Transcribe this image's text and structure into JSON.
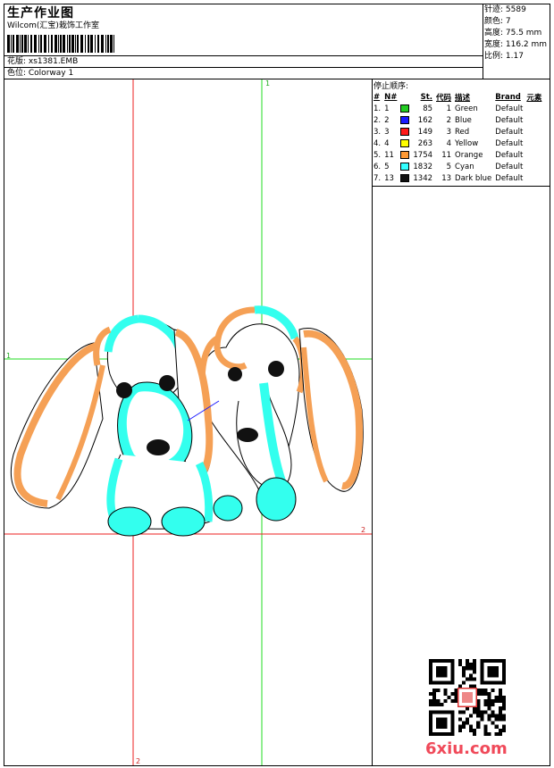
{
  "header": {
    "title": "生产作业图",
    "studio": "Wilcom(汇宝)栽饰工作室",
    "design_label": "花版: xs1381.EMB",
    "colorway_label": "色位: Colorway 1"
  },
  "stats": {
    "stitches": "针迹: 5589",
    "colors": "颜色: 7",
    "height": "高度: 75.5 mm",
    "width": "宽度: 116.2 mm",
    "scale": "比例: 1.17"
  },
  "colorway": {
    "title": "停止顺序:",
    "headers": [
      "#",
      "N#",
      "St.",
      "代码",
      "描述",
      "Brand",
      "元素"
    ],
    "rows": [
      {
        "idx": "1.",
        "n": "1",
        "st": "85",
        "code": "1",
        "desc": "Green",
        "brand": "Default",
        "color": "#22cc22"
      },
      {
        "idx": "2.",
        "n": "2",
        "st": "162",
        "code": "2",
        "desc": "Blue",
        "brand": "Default",
        "color": "#1a1aff"
      },
      {
        "idx": "3.",
        "n": "3",
        "st": "149",
        "code": "3",
        "desc": "Red",
        "brand": "Default",
        "color": "#ff1a1a"
      },
      {
        "idx": "4.",
        "n": "4",
        "st": "263",
        "code": "4",
        "desc": "Yellow",
        "brand": "Default",
        "color": "#ffff00"
      },
      {
        "idx": "5.",
        "n": "11",
        "st": "1754",
        "code": "11",
        "desc": "Orange",
        "brand": "Default",
        "color": "#ff9933"
      },
      {
        "idx": "6.",
        "n": "5",
        "st": "1832",
        "code": "5",
        "desc": "Cyan",
        "brand": "Default",
        "color": "#33ffff"
      },
      {
        "idx": "7.",
        "n": "13",
        "st": "1342",
        "code": "13",
        "desc": "Dark blue",
        "brand": "Default",
        "color": "#111111"
      }
    ]
  },
  "markers": {
    "v_green_top": "1",
    "h_green_left": "1",
    "h_red_right": "2",
    "v_red_bottom": "2"
  },
  "watermark": "6xiu.com"
}
